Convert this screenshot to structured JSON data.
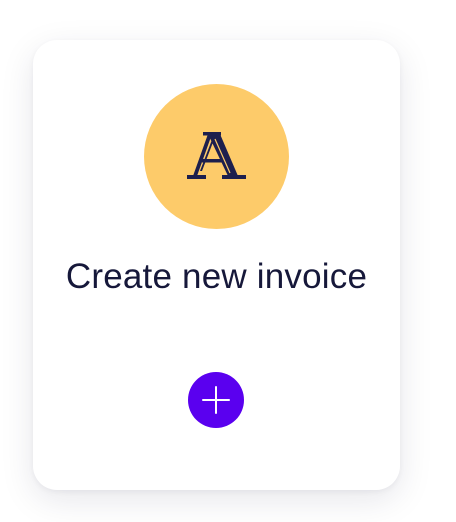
{
  "card": {
    "title": "Create new invoice",
    "logo_icon": "serif-a-logo-icon",
    "add_icon": "plus-icon"
  },
  "colors": {
    "logo_bg": "#fdcb6a",
    "logo_fg": "#1d1f4d",
    "title_text": "#16183a",
    "add_button": "#5a00ef"
  }
}
